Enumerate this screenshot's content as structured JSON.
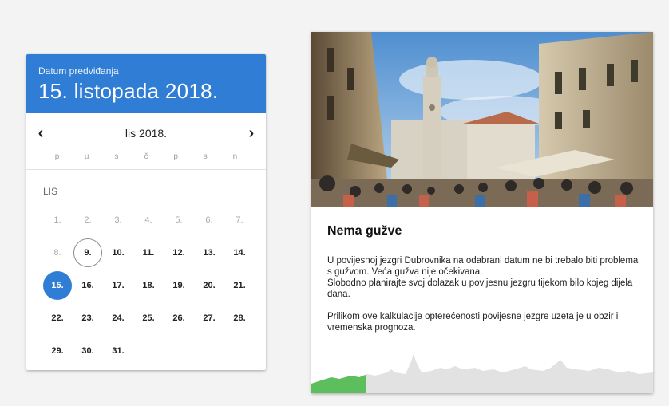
{
  "calendar": {
    "header_label": "Datum predviđanja",
    "header_date": "15. listopada 2018.",
    "month_label": "lis 2018.",
    "prev_icon": "chevron-left-icon",
    "next_icon": "chevron-right-icon",
    "weekdays": [
      "p",
      "u",
      "s",
      "č",
      "p",
      "s",
      "n"
    ],
    "month_short": "LIS",
    "weeks": [
      [
        "1.",
        "2.",
        "3.",
        "4.",
        "5.",
        "6.",
        "7."
      ],
      [
        "8.",
        "9.",
        "10.",
        "11.",
        "12.",
        "13.",
        "14."
      ],
      [
        "15.",
        "16.",
        "17.",
        "18.",
        "19.",
        "20.",
        "21."
      ],
      [
        "22.",
        "23.",
        "24.",
        "25.",
        "26.",
        "27.",
        "28."
      ],
      [
        "29.",
        "30.",
        "31.",
        "",
        "",
        "",
        ""
      ]
    ],
    "disabled_days": [
      "1.",
      "2.",
      "3.",
      "4.",
      "5.",
      "6.",
      "7.",
      "8."
    ],
    "today": "9.",
    "selected": "15.",
    "accent_color": "#2f7dd4"
  },
  "card": {
    "title": "Nema gužve",
    "paragraph1_line1": "U povijesnoj jezgri Dubrovnika na odabrani datum ne bi trebalo biti problema s gužvom. Veća gužva nije očekivana.",
    "paragraph1_line2": "Slobodno planirajte svoj dolazak u povijesnu jezgru tijekom bilo kojeg dijela dana.",
    "paragraph2": "Prilikom ove kalkulacije opterećenosti povijesne jezgre uzeta je u obzir i vremenska prognoza.",
    "crowd_level_color": "#5cbe5c"
  }
}
